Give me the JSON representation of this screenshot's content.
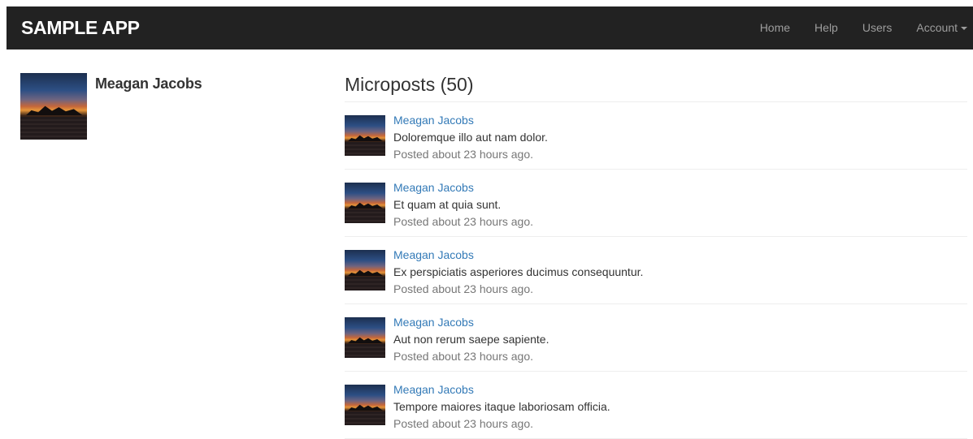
{
  "nav": {
    "brand": "SAMPLE APP",
    "links": [
      "Home",
      "Help",
      "Users"
    ],
    "account": "Account"
  },
  "profile": {
    "name": "Meagan Jacobs",
    "avatar_icon": "sunset-avatar-image"
  },
  "microposts": {
    "title": "Microposts (50)",
    "posts": [
      {
        "user": "Meagan Jacobs",
        "content": "Doloremque illo aut nam dolor.",
        "timestamp": "Posted about 23 hours ago."
      },
      {
        "user": "Meagan Jacobs",
        "content": "Et quam at quia sunt.",
        "timestamp": "Posted about 23 hours ago."
      },
      {
        "user": "Meagan Jacobs",
        "content": "Ex perspiciatis asperiores ducimus consequuntur.",
        "timestamp": "Posted about 23 hours ago."
      },
      {
        "user": "Meagan Jacobs",
        "content": "Aut non rerum saepe sapiente.",
        "timestamp": "Posted about 23 hours ago."
      },
      {
        "user": "Meagan Jacobs",
        "content": "Tempore maiores itaque laboriosam officia.",
        "timestamp": "Posted about 23 hours ago."
      }
    ]
  },
  "colors": {
    "navbar": "#222222",
    "nav_link": "#9d9d9d",
    "link": "#337ab7",
    "muted": "#777777"
  }
}
